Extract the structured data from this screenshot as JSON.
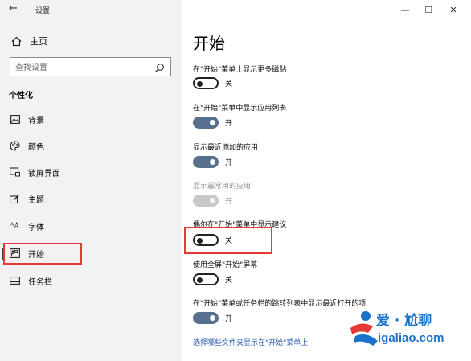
{
  "window": {
    "back_glyph": "←",
    "title": "设置",
    "min_glyph": "—",
    "max_glyph": "☐",
    "close_glyph": "✕"
  },
  "sidebar": {
    "home_label": "主页",
    "search_placeholder": "查找设置",
    "section_title": "个性化",
    "items": [
      {
        "label": "背景",
        "icon": "image-icon"
      },
      {
        "label": "颜色",
        "icon": "palette-icon"
      },
      {
        "label": "锁屏界面",
        "icon": "lock-screen-icon"
      },
      {
        "label": "主题",
        "icon": "brush-icon"
      },
      {
        "label": "字体",
        "icon": "font-icon"
      },
      {
        "label": "开始",
        "icon": "start-icon",
        "active": true
      },
      {
        "label": "任务栏",
        "icon": "taskbar-icon"
      }
    ]
  },
  "main": {
    "title": "开始",
    "settings": [
      {
        "label": "在\"开始\"菜单上显示更多磁贴",
        "state": "关",
        "on": false
      },
      {
        "label": "在\"开始\"菜单中显示应用列表",
        "state": "开",
        "on": true
      },
      {
        "label": "显示最近添加的应用",
        "state": "开",
        "on": true
      },
      {
        "label": "显示最常用的应用",
        "state": "开",
        "on": true,
        "disabled": true
      },
      {
        "label": "偶尔在\"开始\"菜单中显示建议",
        "state": "关",
        "on": false
      },
      {
        "label": "使用全屏\"开始\"屏幕",
        "state": "关",
        "on": false
      },
      {
        "label": "在\"开始\"菜单或任务栏的跳转列表中显示最近打开的项",
        "state": "开",
        "on": true
      }
    ],
    "link": "选择哪些文件夹显示在\"开始\"菜单上"
  },
  "watermark": {
    "line1": "爱 · 尬聊",
    "line2": "igaliao.com"
  },
  "colors": {
    "toggle_on": "#566f8c",
    "highlight": "#e53935",
    "link": "#2a5db0",
    "sidebar_bg": "#f2f2f2"
  }
}
